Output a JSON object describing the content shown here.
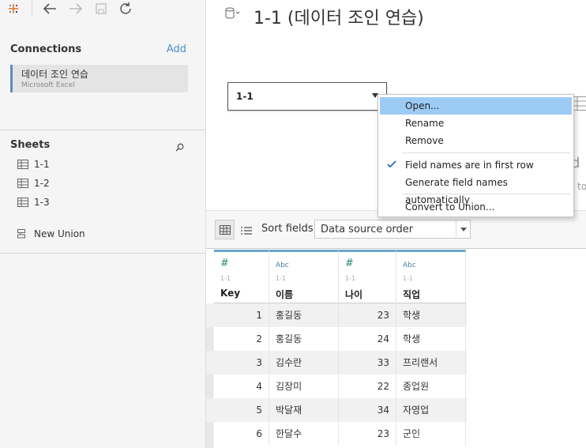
{
  "toolbar": {
    "icons": [
      "tableau-logo-icon",
      "back-arrow-icon",
      "forward-arrow-icon",
      "save-icon",
      "refresh-icon"
    ]
  },
  "connections": {
    "title": "Connections",
    "add_label": "Add",
    "item": {
      "name": "데이터 조인 연습",
      "type": "Microsoft Excel"
    }
  },
  "sheets": {
    "title": "Sheets",
    "items": [
      {
        "label": "1-1"
      },
      {
        "label": "1-2"
      },
      {
        "label": "1-3"
      }
    ],
    "new_union": "New Union"
  },
  "datasource": {
    "title": "1-1 (데이터 조인 연습)"
  },
  "canvas": {
    "table_label": "1-1",
    "partial_text_1": "d I",
    "partial_text_2": "to"
  },
  "context_menu": {
    "items": [
      {
        "label": "Open...",
        "highlighted": true
      },
      {
        "label": "Rename"
      },
      {
        "label": "Remove"
      },
      {
        "label": "Field names are in first row",
        "checked": true
      },
      {
        "label": "Generate field names automatically"
      },
      {
        "label": "Convert to Union..."
      }
    ]
  },
  "grid_toolbar": {
    "sort_label": "Sort fields",
    "sort_value": "Data source order"
  },
  "columns": [
    {
      "type_icon": "#",
      "type": "number",
      "source": "1-1",
      "name": "Key"
    },
    {
      "type_icon": "Abc",
      "type": "string",
      "source": "1-1",
      "name": "이름"
    },
    {
      "type_icon": "#",
      "type": "number",
      "source": "1-1",
      "name": "나이"
    },
    {
      "type_icon": "Abc",
      "type": "string",
      "source": "1-1",
      "name": "직업"
    }
  ],
  "rows": [
    [
      "1",
      "홍길동",
      "23",
      "학생"
    ],
    [
      "2",
      "홍길동",
      "24",
      "학생"
    ],
    [
      "3",
      "김수란",
      "33",
      "프리랜서"
    ],
    [
      "4",
      "김장미",
      "22",
      "종업원"
    ],
    [
      "5",
      "박달재",
      "34",
      "자영업"
    ],
    [
      "6",
      "한달수",
      "23",
      "군인"
    ]
  ]
}
